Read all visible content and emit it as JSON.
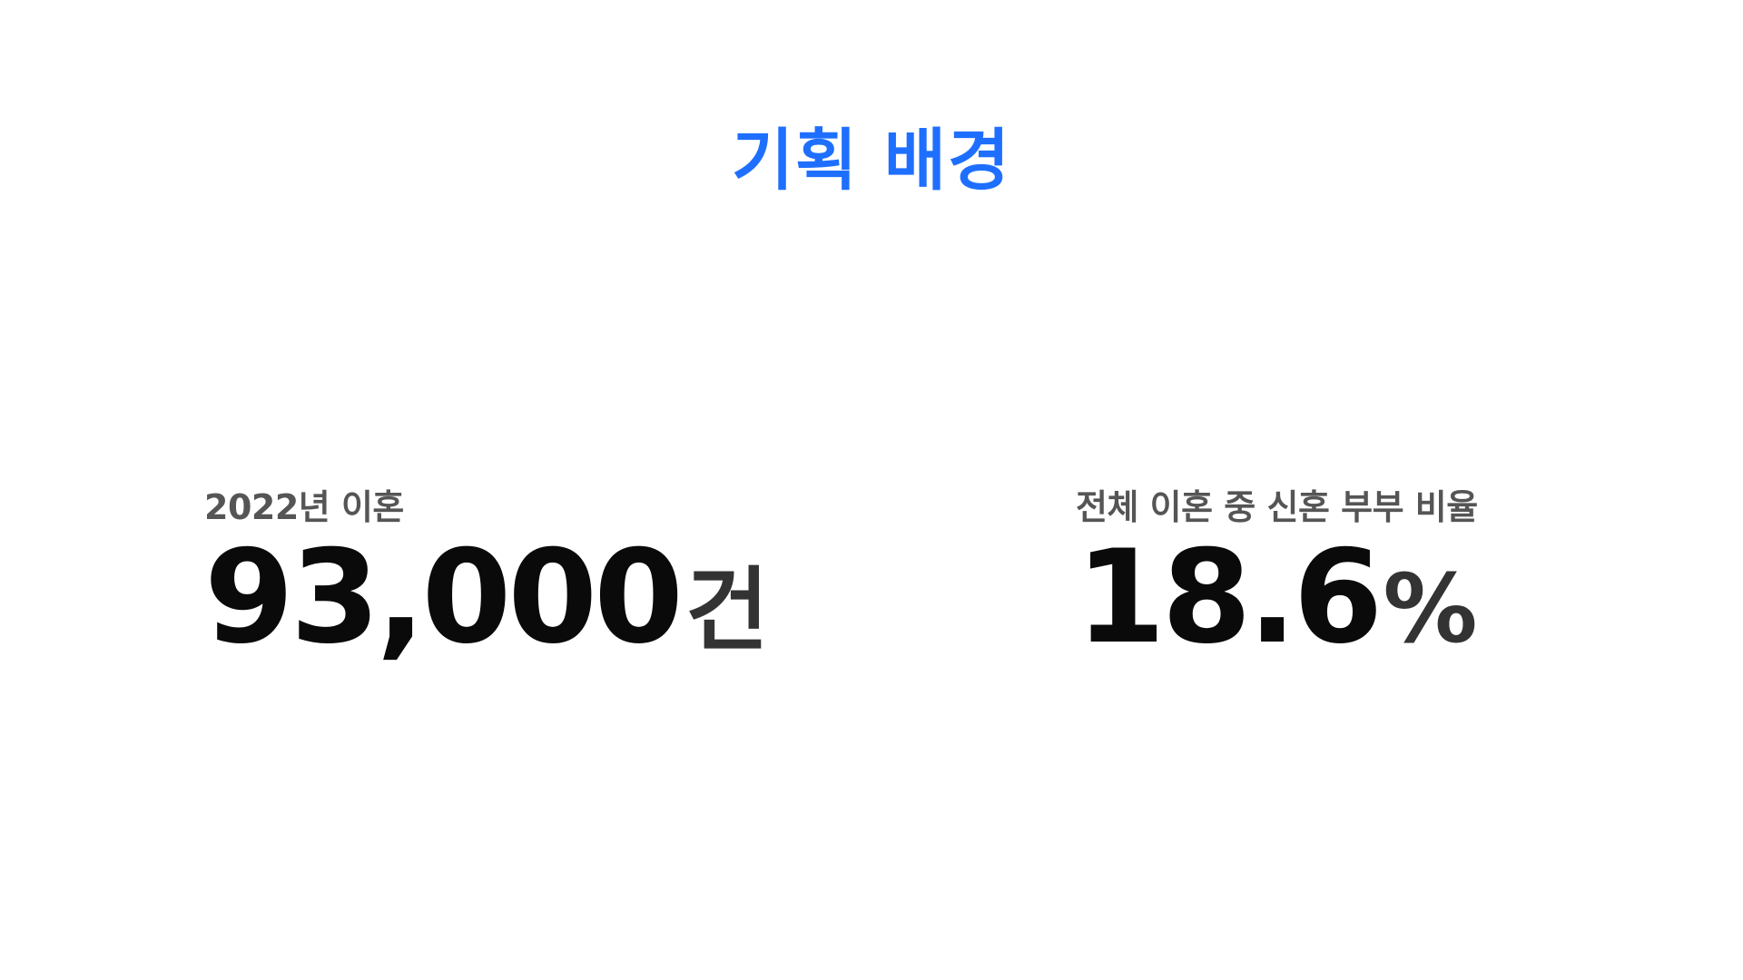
{
  "slide": {
    "title": "기획 배경",
    "stats": [
      {
        "label": "2022년 이혼",
        "value": "93,000",
        "unit": "건"
      },
      {
        "label": "전체 이혼 중 신혼 부부 비율",
        "value": "18.6",
        "unit": "%"
      }
    ]
  },
  "colors": {
    "title": "#1f6fff",
    "label": "#555555",
    "number": "#0a0a0a",
    "unit": "#333333",
    "background": "#ffffff"
  }
}
